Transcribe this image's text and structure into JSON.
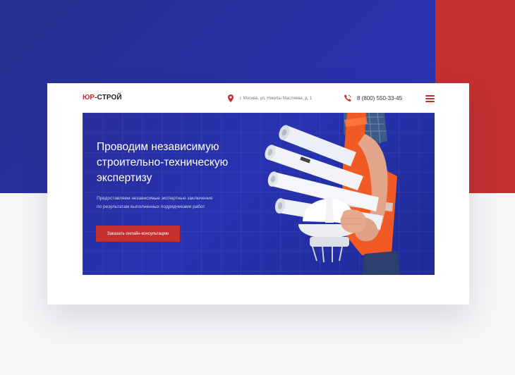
{
  "header": {
    "logo_prefix": "ЮР",
    "logo_suffix": "-СТРОЙ",
    "address": "г. Москва, ул. Никиты Масляева, д. 1",
    "phone": "8 (800) 550-33-45"
  },
  "hero": {
    "title_lines": [
      "Проводим независимую",
      "строительно-техническую",
      "экспертизу"
    ],
    "subtitle_lines": [
      "Предоставляем независимые экспертные заключения",
      "по  результатам выполненных подрядчиками работ"
    ],
    "cta_label": "Заказать онлайн-консультацию"
  },
  "colors": {
    "brand_blue": "#2a31a6",
    "brand_red": "#c43030",
    "worker_vest": "#f15a24"
  },
  "icons": {
    "address": "map-pin-icon",
    "phone": "phone-icon",
    "menu": "hamburger-menu-icon"
  }
}
